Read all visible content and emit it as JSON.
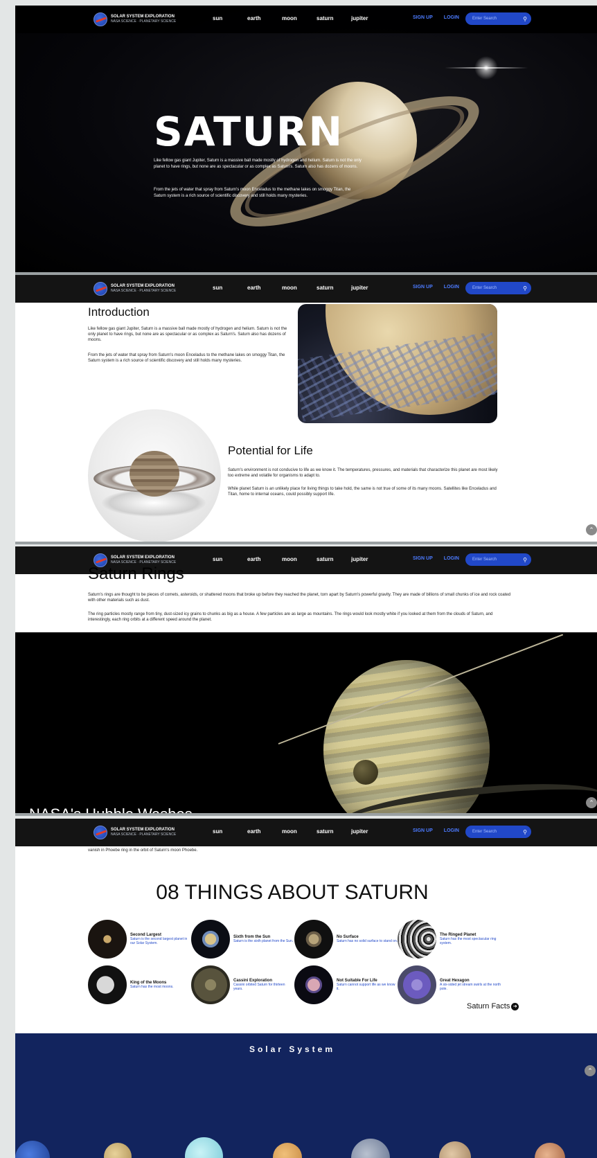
{
  "nav": {
    "logo_line1": "SOLAR SYSTEM EXPLORATION",
    "logo_line2": "NASA SCIENCE · PLANETARY SCIENCE",
    "links": [
      "sun",
      "earth",
      "moon",
      "saturn",
      "jupiter"
    ],
    "signup": "SIGN UP",
    "login": "LOGIN",
    "search_placeholder": "Enter Search"
  },
  "hero": {
    "title": "SATURN",
    "para1": "Like fellow gas giant Jupiter, Saturn is a massive ball made mostly of hydrogen and helium. Saturn is not the only planet to have rings, but none are as spectacular or as complex as Saturn's. Saturn also has dozens of moons.",
    "para2": "From the jets of water that spray from Saturn's moon Enceladus to the methane lakes on smoggy Titan, the Saturn system is a rich source of scientific discovery and still holds many mysteries."
  },
  "intro": {
    "title": "Introduction",
    "para1": "Like fellow gas giant Jupiter, Saturn is a massive ball made mostly of hydrogen and helium. Saturn is not the only planet to have rings, but none are as spectacular or as complex as Saturn's. Saturn also has dozens of moons.",
    "para2": "From the jets of water that spray from Saturn's moon Enceladus to the methane lakes on smoggy Titan, the Saturn system is a rich source of scientific discovery and still holds many mysteries."
  },
  "life": {
    "title": "Potential for Life",
    "para1": "Saturn's environment is not conducive to life as we know it. The temperatures, pressures, and materials that characterize this planet are most likely too extreme and volatile for organisms to adapt to.",
    "para2": "While planet Saturn is an unlikely place for living things to take hold, the same is not true of some of its many moons. Satellites like Enceladus and Titan, home to internal oceans, could possibly support life."
  },
  "rings_section": {
    "title": "Saturn Rings",
    "para1": "Saturn's rings are thought to be pieces of comets, asteroids, or shattered moons that broke up before they reached the planet, torn apart by Saturn's powerful gravity. They are made of billions of small chunks of ice and rock coated with other materials such as dust.",
    "para2": "The ring particles mostly range from tiny, dust-sized icy grains to chunks as big as a house. A few particles are as large as mountains. The rings would look mostly white if you looked at them from the clouds of Saturn, and interestingly, each ring orbits at a different speed around the planet.",
    "hubble": "NASA's Hubble Washes"
  },
  "things": {
    "pre_line": "vanish in Phoebe ring in the orbit of Saturn's moon Phoebe.",
    "title": "08 THINGS ABOUT SATURN",
    "cards": [
      {
        "title": "Second Largest",
        "desc": "Saturn is the second largest planet in our Solar System."
      },
      {
        "title": "Sixth from the Sun",
        "desc": "Saturn is the sixth planet from the Sun."
      },
      {
        "title": "No Surface",
        "desc": "Saturn has no solid surface to stand on."
      },
      {
        "title": "The Ringed Planet",
        "desc": "Saturn has the most spectacular ring system."
      },
      {
        "title": "King of the Moons",
        "desc": "Saturn has the most moons."
      },
      {
        "title": "Cassini Exploration",
        "desc": "Cassini orbited Saturn for thirteen years."
      },
      {
        "title": "Not Suitable For Life",
        "desc": "Saturn cannot support life as we know it."
      },
      {
        "title": "Great Hexagon",
        "desc": "A six-sided jet stream swirls at the north pole."
      }
    ],
    "facts_link": "Saturn Facts"
  },
  "solar": {
    "title": "Solar System"
  },
  "colors": {
    "nav_bg": "#000000",
    "accent_blue": "#2148c8",
    "solar_bg": "#12245e"
  }
}
